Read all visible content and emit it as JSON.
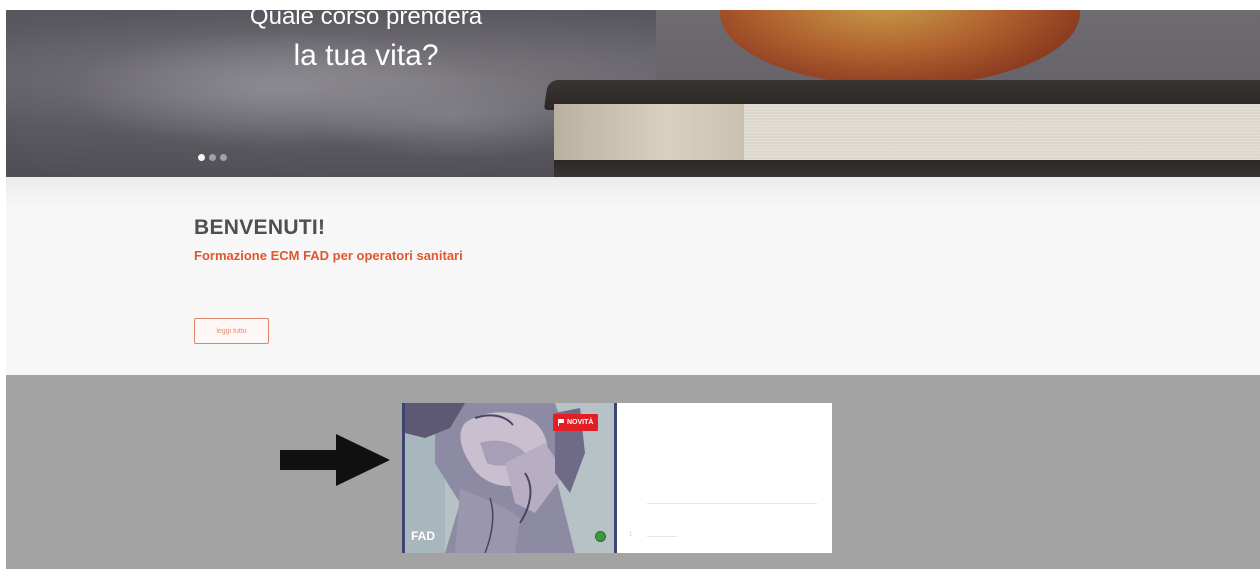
{
  "hero": {
    "title_line1": "Quale corso prenderà",
    "title_line2": "la tua vita?",
    "slides": 3,
    "active_slide": 1
  },
  "welcome": {
    "title": "BENVENUTI!",
    "subtitle": "Formazione ECM FAD per operatori sanitari",
    "read_more_label": "leggi tutto"
  },
  "course_card": {
    "badge_label": "NOVITÀ",
    "type_label": "FAD",
    "info_index": "1"
  },
  "colors": {
    "accent": "#e0572e",
    "badge": "#e31e24",
    "status": "#3a9a3c",
    "section_gray": "#a3a3a3"
  },
  "icons": [
    "arrow-right-icon",
    "flag-icon",
    "status-dot-icon"
  ]
}
